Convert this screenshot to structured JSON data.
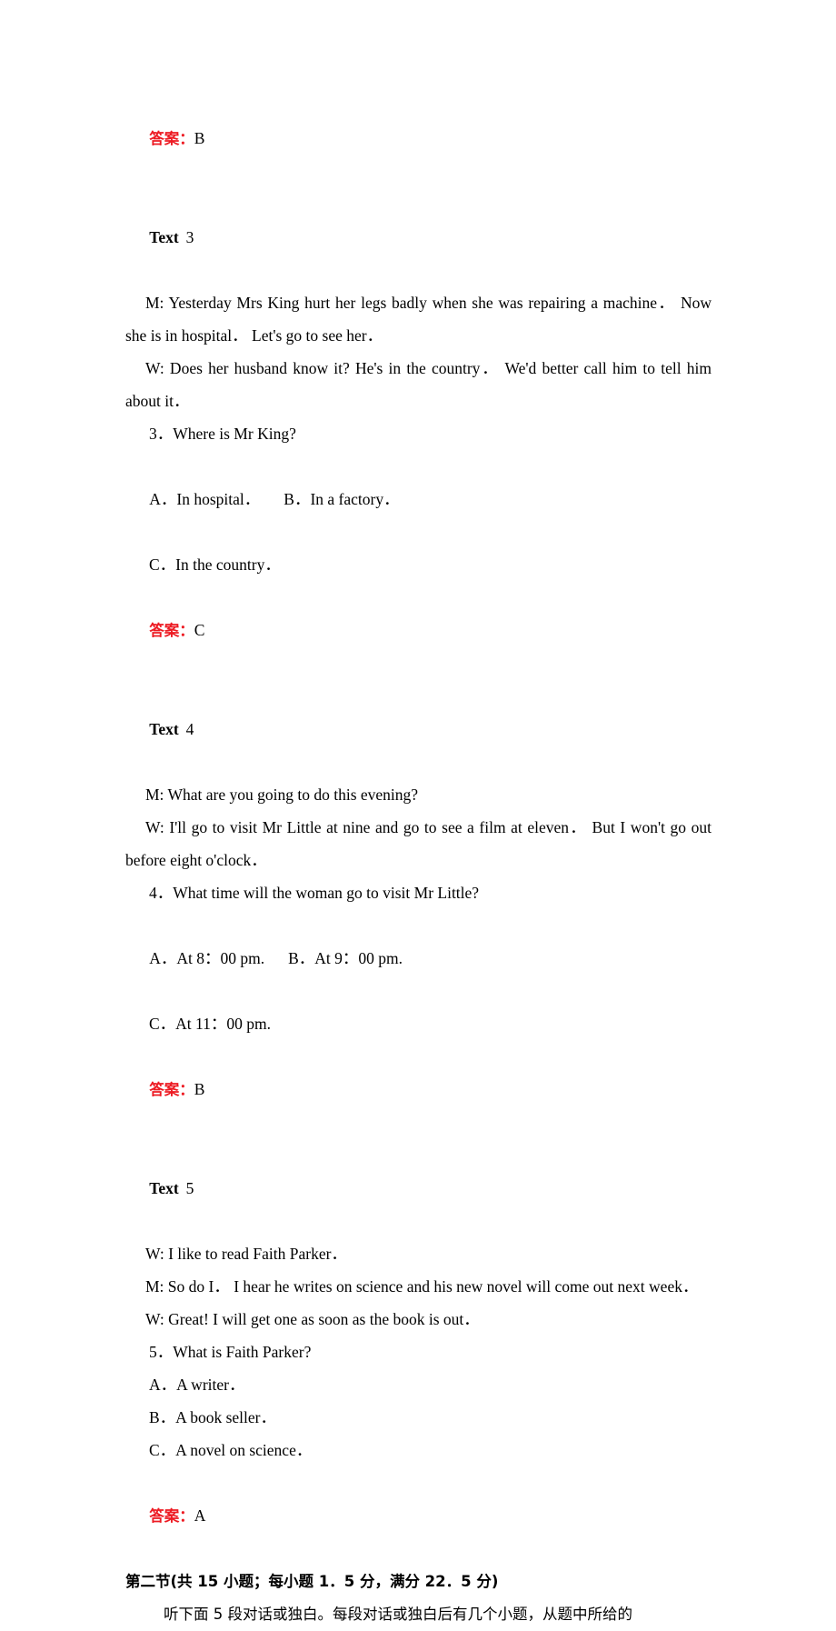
{
  "document": {
    "accent_red": "#ED1B23",
    "text_color": "#000000",
    "background": "#ffffff",
    "answer_label": "答案",
    "colon": "："
  },
  "blocks": {
    "answer_2": {
      "label": "答案",
      "colon": "：",
      "value": "B"
    },
    "text3": {
      "heading_keyword": "Text",
      "heading_number": "3",
      "line_m": "M: Yesterday Mrs King hurt her legs badly when she was repairing a machine． Now she is in hospital． Let's go to see her．",
      "line_w": "W: Does her husband know it? He's in the country． We'd better call him to tell him about it．"
    },
    "question_3": {
      "stem": "3．Where is Mr King?",
      "option_a": "A．In hospital．",
      "option_b": "B．In a factory．",
      "option_c": "C．In the country．"
    },
    "answer_3": {
      "label": "答案",
      "colon": "：",
      "value": "C"
    },
    "text4": {
      "heading_keyword": "Text",
      "heading_number": "4",
      "line_m": "M: What are you going to do this evening?",
      "line_w": "W: I'll go to visit Mr Little at nine and go to see a film at eleven． But I won't go out before eight o'clock．"
    },
    "question_4": {
      "stem": "4．What time will the woman go to visit Mr Little?",
      "option_a": "A．At 8：00 pm.",
      "option_b": "B．At 9：00 pm.",
      "option_c": "C．At 11：00 pm."
    },
    "answer_4": {
      "label": "答案",
      "colon": "：",
      "value": "B"
    },
    "text5": {
      "heading_keyword": "Text",
      "heading_number": "5",
      "line_w1": "W: I like to read Faith Parker．",
      "line_m": "M: So do I． I hear he writes on science and his new novel will come out next week．",
      "line_w2": "W: Great! I will get one as soon as the book is out．"
    },
    "question_5": {
      "stem": "5．What is Faith Parker?",
      "option_a": "A．A writer．",
      "option_b": "B．A book seller．",
      "option_c": "C．A novel on science．"
    },
    "answer_5": {
      "label": "答案",
      "colon": "：",
      "value": "A"
    },
    "section_two": {
      "heading": "第二节(共 15 小题；每小题 1．5 分，满分 22．5 分)",
      "instruction": "听下面 5 段对话或独白。每段对话或独白后有几个小题，从题中所给的"
    }
  }
}
